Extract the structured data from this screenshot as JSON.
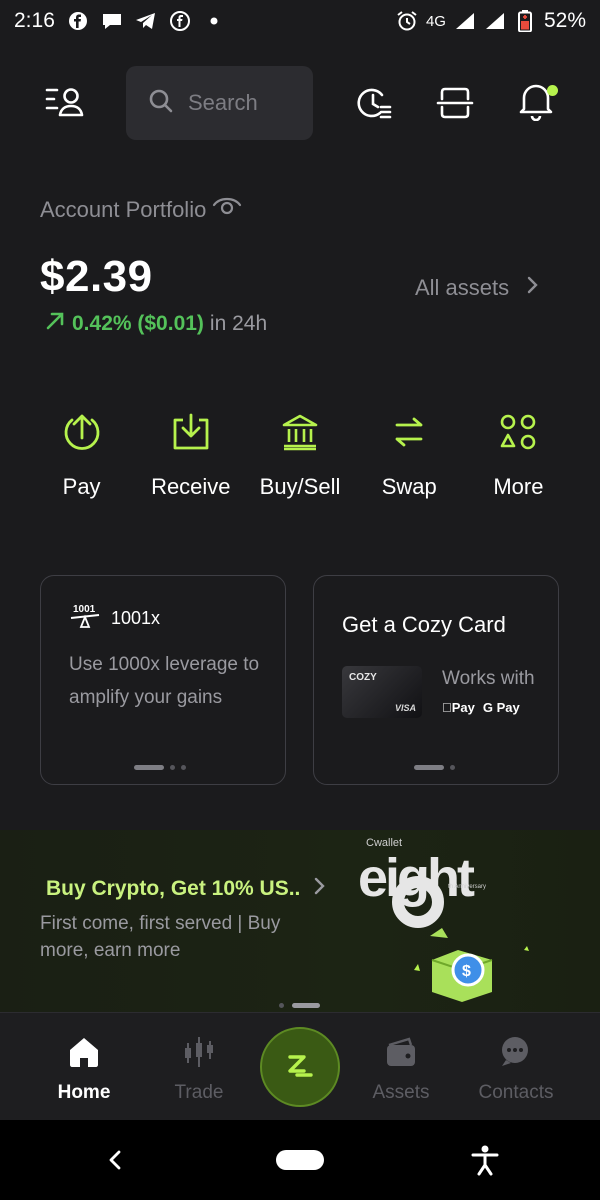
{
  "status_bar": {
    "time": "2:16",
    "network": "4G",
    "battery": "52%",
    "notif_icons": [
      "facebook-icon",
      "chat-icon",
      "telegram-icon",
      "messenger-icon",
      "dot-icon"
    ],
    "right_icons": [
      "alarm-icon",
      "signal-icon",
      "signal-icon",
      "battery-icon"
    ]
  },
  "header": {
    "search_placeholder": "Search",
    "icons": [
      "profile-menu-icon",
      "history-icon",
      "scan-icon",
      "bell-icon"
    ]
  },
  "portfolio": {
    "label": "Account Portfolio",
    "balance": "$2.39",
    "change_pct": "0.42% ($0.01)",
    "change_period": "in 24h",
    "all_assets": "All assets"
  },
  "actions": [
    {
      "label": "Pay",
      "icon": "pay-icon"
    },
    {
      "label": "Receive",
      "icon": "receive-icon"
    },
    {
      "label": "Buy/Sell",
      "icon": "bank-icon"
    },
    {
      "label": "Swap",
      "icon": "swap-icon"
    },
    {
      "label": "More",
      "icon": "more-icon"
    }
  ],
  "cards": {
    "leverage": {
      "badge": "1001",
      "title": "1001x",
      "body": "Use 1000x leverage to amplify your gains"
    },
    "cozy": {
      "title": "Get a Cozy Card",
      "card_brand": "COZY",
      "card_network": "VISA",
      "works_with": "Works with",
      "apple_pay": "Pay",
      "google_pay": "G Pay"
    }
  },
  "banner": {
    "title": "Buy Crypto, Get 10% US..",
    "subtitle": "First come, first served | Buy more, earn more",
    "art_brand": "Cwallet",
    "art_word": "eight",
    "art_caption": "th Anniversary"
  },
  "bottom_nav": {
    "items": [
      {
        "label": "Home",
        "icon": "home-icon"
      },
      {
        "label": "Trade",
        "icon": "candlestick-icon"
      },
      {
        "label": "Assets",
        "icon": "wallet-icon"
      },
      {
        "label": "Contacts",
        "icon": "chat-bubbles-icon"
      }
    ]
  },
  "colors": {
    "background": "#1b1b1d",
    "accent": "#b6f24d",
    "positive": "#54c25a",
    "muted": "#8e8e94"
  }
}
